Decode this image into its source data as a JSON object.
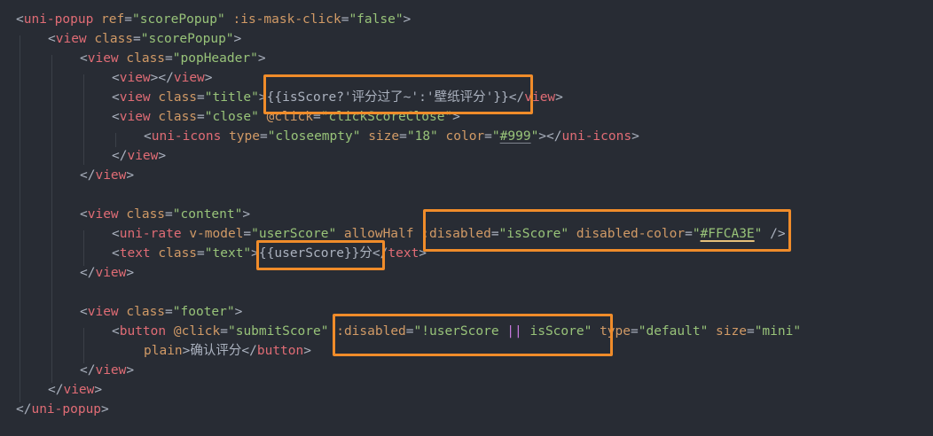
{
  "code": {
    "l1": [
      "<",
      "uni-popup",
      " ",
      "ref",
      "=",
      "\"scorePopup\"",
      " ",
      ":is-mask-click",
      "=",
      "\"false\"",
      ">"
    ],
    "l2": [
      "<",
      "view",
      " ",
      "class",
      "=",
      "\"scorePopup\"",
      ">"
    ],
    "l3": [
      "<",
      "view",
      " ",
      "class",
      "=",
      "\"popHeader\"",
      ">"
    ],
    "l4": [
      "<",
      "view",
      "></",
      "view",
      ">"
    ],
    "l5": [
      "<",
      "view",
      " ",
      "class",
      "=",
      "\"title\"",
      ">",
      "{{isScore?'评分过了~':'壁纸评分'}}",
      "</",
      "view",
      ">"
    ],
    "l6": [
      "<",
      "view",
      " ",
      "class",
      "=",
      "\"close\"",
      " ",
      "@click",
      "=",
      "\"clickScoreClose\"",
      ">"
    ],
    "l7": [
      "<",
      "uni-icons",
      " ",
      "type",
      "=",
      "\"closeempty\"",
      " ",
      "size",
      "=",
      "\"18\"",
      " ",
      "color",
      "=",
      "\"",
      "#999",
      "\"",
      "></",
      "uni-icons",
      ">"
    ],
    "l8": [
      "</",
      "view",
      ">"
    ],
    "l9": [
      "</",
      "view",
      ">"
    ],
    "l11": [
      "<",
      "view",
      " ",
      "class",
      "=",
      "\"content\"",
      ">"
    ],
    "l12": [
      "<",
      "uni-rate",
      " ",
      "v-model",
      "=",
      "\"userScore\"",
      " ",
      "allowHalf",
      " ",
      ":disabled",
      "=",
      "\"isScore\"",
      " ",
      "disabled-color",
      "=",
      "\"",
      "#FFCA3E",
      "\"",
      " />"
    ],
    "l13": [
      "<",
      "text",
      " ",
      "class",
      "=",
      "\"text\"",
      ">",
      "{{userScore}}",
      "分",
      "</",
      "text",
      ">"
    ],
    "l14": [
      "</",
      "view",
      ">"
    ],
    "l16": [
      "<",
      "view",
      " ",
      "class",
      "=",
      "\"footer\"",
      ">"
    ],
    "l17": [
      "<",
      "button",
      " ",
      "@click",
      "=",
      "\"submitScore\"",
      " ",
      ":disabled",
      "=",
      "\"!userScore ",
      "||",
      " isScore\"",
      " ",
      "type",
      "=",
      "\"default\"",
      " ",
      "size",
      "=",
      "\"mini\""
    ],
    "l18": [
      "plain",
      ">",
      "确认评分",
      "</",
      "button",
      ">"
    ],
    "l19": [
      "</",
      "view",
      ">"
    ],
    "l20": [
      "</",
      "view",
      ">"
    ],
    "l21": [
      "</",
      "uni-popup",
      ">"
    ]
  },
  "colors": {
    "background": "#282c34",
    "tag": "#e06c75",
    "attribute": "#d19a66",
    "string": "#98c379",
    "text": "#abb2bf",
    "operator": "#c678dd",
    "highlight_box": "#f08c2a"
  }
}
